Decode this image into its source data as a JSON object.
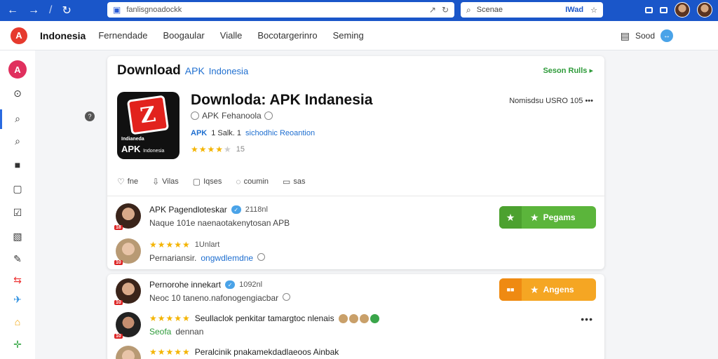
{
  "browser": {
    "address": "fanlisgnoadockk",
    "search_placeholder": "Scenae",
    "search_tag": "IWad"
  },
  "nav": {
    "brand": "Indonesia",
    "menu": [
      "Fernendade",
      "Boogaular",
      "Vialle",
      "Bocotargerinro",
      "Seming"
    ],
    "right_label": "Sood"
  },
  "header": {
    "title": "Download",
    "apk": "APK",
    "region": "Indonesia",
    "seen_label": "Seson Rulls"
  },
  "app": {
    "icon_caption_top": "Indianeda",
    "icon_caption_apk": "APK",
    "icon_caption_small": "Indonesia",
    "title": "Downloda: APK Indanesia",
    "subtitle_apk": "APK",
    "subtitle_name": "Fehanoola",
    "meta_a": "APK",
    "meta_b": "1 Salk. 1",
    "meta_c": "sichodhic Reoantion",
    "rating_count": "15",
    "right_meta": "Nomisdsu USRO 105"
  },
  "tabs": [
    {
      "icon": "♡",
      "label": "fne"
    },
    {
      "icon": "⇩",
      "label": "Vilas"
    },
    {
      "icon": "▢",
      "label": "Iqses"
    },
    {
      "icon": "◌",
      "label": "coumin"
    },
    {
      "icon": "▭",
      "label": "sas"
    }
  ],
  "reviews_card1": [
    {
      "badge": "18",
      "name": "APK Pagendloteskar",
      "count": "2118nl",
      "text": "Naque 101e naenaotakenytosan APB",
      "button": "Pegams"
    },
    {
      "badge": "10",
      "count": "1Unlart",
      "text_prefix": "Pernariansir.",
      "text_link": "ongwdlemdne"
    }
  ],
  "reviews_card2": [
    {
      "badge": "10",
      "name": "Pernorohe innekart",
      "count": "1092nl",
      "text": "Neoc 10 taneno.nafonogengiacbar",
      "button": "Angens"
    },
    {
      "badge": "10",
      "text": "Seullaclok penkitar tamargtoc nlenais",
      "sub_link": "Seofa",
      "sub_text": "dennan"
    },
    {
      "badge": "10",
      "text": "Peralcinik pnakamekdadlaeoos Ainbak"
    }
  ],
  "colors": {
    "browser_bar": "#1a56c9",
    "brand_red": "#e63a2e",
    "link_blue": "#1f6fd0",
    "green_button": "#5bb53b",
    "orange_button": "#f5a623",
    "star": "#f4b400"
  }
}
